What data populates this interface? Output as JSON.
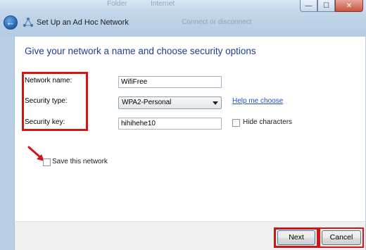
{
  "window": {
    "title": "Set Up an Ad Hoc Network",
    "background_text": [
      "Folder",
      "Internet",
      "Connect or disconnect"
    ],
    "controls": {
      "minimize": "—",
      "maximize": "☐",
      "close": "✕"
    }
  },
  "main": {
    "heading": "Give your network a name and choose security options",
    "network_name_label": "Network name:",
    "network_name_value": "WifiFree",
    "security_type_label": "Security type:",
    "security_type_value": "WPA2-Personal",
    "security_key_label": "Security key:",
    "security_key_value": "hihihehe10",
    "help_link": "Help me choose",
    "hide_characters_label": "Hide characters",
    "hide_characters_checked": false,
    "save_network_label": "Save this network",
    "save_network_checked": false
  },
  "footer": {
    "next_label": "Next",
    "cancel_label": "Cancel"
  },
  "colors": {
    "heading": "#1e3f8a",
    "highlight": "#d01515",
    "link": "#1f4fbf"
  },
  "icons": [
    "back-arrow-icon",
    "network-icon",
    "red-arrow-icon"
  ]
}
